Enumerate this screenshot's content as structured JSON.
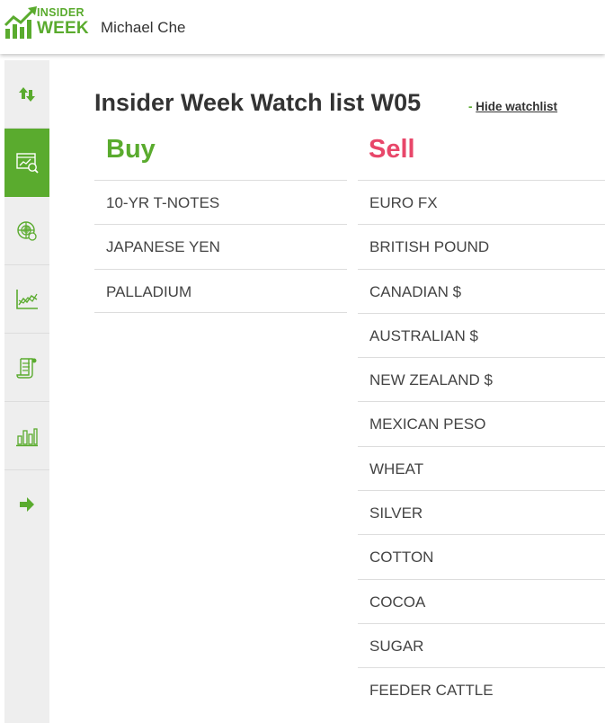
{
  "header": {
    "logo": {
      "line1": "INSIDER",
      "line2": "WEEK",
      "icon": "growth-chart-icon"
    },
    "user_name": "Michael Che"
  },
  "sidebar": {
    "items": [
      {
        "icon": "sort-arrows-icon",
        "active": false
      },
      {
        "icon": "chart-window-icon",
        "active": true
      },
      {
        "icon": "radar-chart-icon",
        "active": false
      },
      {
        "icon": "line-chart-icon",
        "active": false
      },
      {
        "icon": "scroll-document-icon",
        "active": false
      },
      {
        "icon": "bar-chart-icon",
        "active": false
      },
      {
        "icon": "arrow-right-icon",
        "active": false
      }
    ]
  },
  "colors": {
    "accent_green": "#5aab2e",
    "sell_red": "#e8476a"
  },
  "main": {
    "title": "Insider Week Watch list W05",
    "hide_dash": "-",
    "hide_link": "Hide watchlist",
    "buy": {
      "heading": "Buy",
      "items": [
        "10-YR T-NOTES",
        "JAPANESE YEN",
        "PALLADIUM"
      ]
    },
    "sell": {
      "heading": "Sell",
      "items": [
        "EURO FX",
        "BRITISH POUND",
        "CANADIAN $",
        "AUSTRALIAN $",
        "NEW ZEALAND $",
        "MEXICAN PESO",
        "WHEAT",
        "SILVER",
        "COTTON",
        "COCOA",
        "SUGAR",
        "FEEDER CATTLE"
      ]
    }
  }
}
